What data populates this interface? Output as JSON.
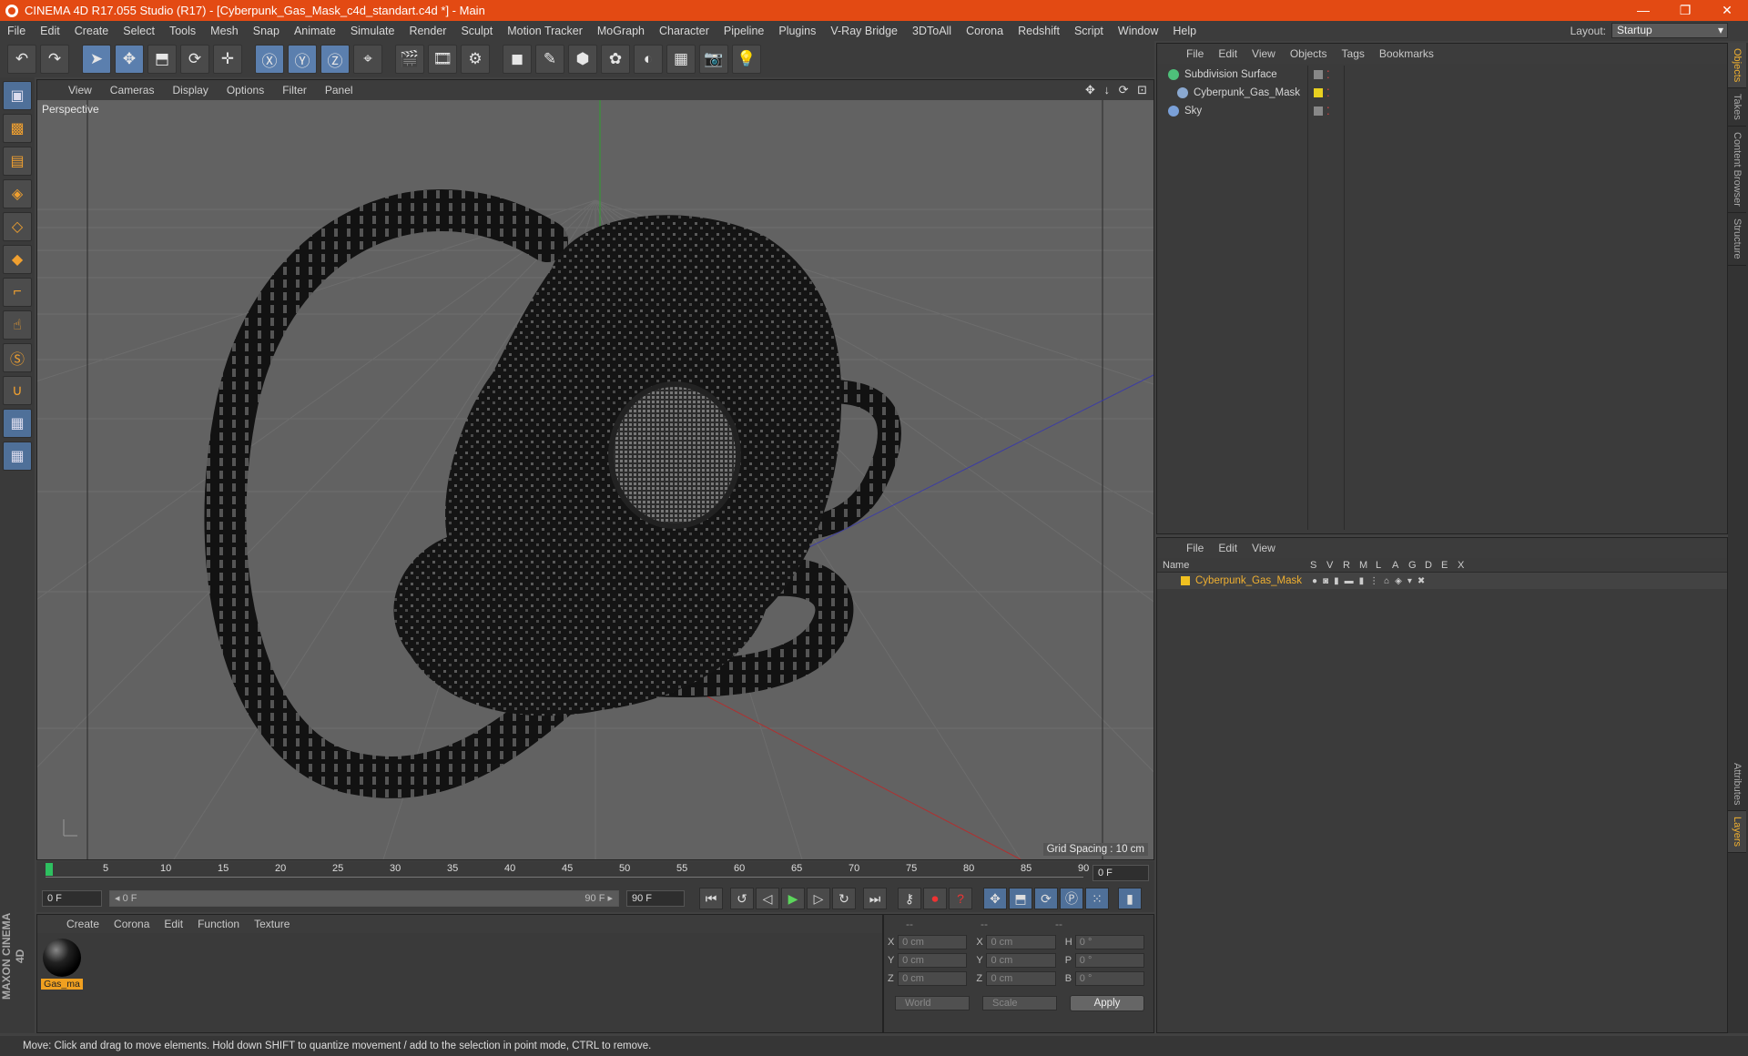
{
  "window": {
    "title": "CINEMA 4D R17.055 Studio (R17) - [Cyberpunk_Gas_Mask_c4d_standart.c4d *] - Main",
    "minimize": "—",
    "restore": "❐",
    "close": "✕"
  },
  "menu": [
    "File",
    "Edit",
    "Create",
    "Select",
    "Tools",
    "Mesh",
    "Snap",
    "Animate",
    "Simulate",
    "Render",
    "Sculpt",
    "Motion Tracker",
    "MoGraph",
    "Character",
    "Pipeline",
    "Plugins",
    "V-Ray Bridge",
    "3DToAll",
    "Corona",
    "Redshift",
    "Script",
    "Window",
    "Help"
  ],
  "layout": {
    "label": "Layout:",
    "value": "Startup"
  },
  "toolbar": [
    {
      "name": "undo-icon",
      "glyph": "↶"
    },
    {
      "name": "redo-icon",
      "glyph": "↷"
    },
    {
      "name": "select-arrow-icon",
      "glyph": "➤",
      "active": true
    },
    {
      "name": "move-icon",
      "glyph": "✥",
      "active": true
    },
    {
      "name": "scale-icon",
      "glyph": "⬒"
    },
    {
      "name": "rotate-icon",
      "glyph": "⟳"
    },
    {
      "name": "move-plus-icon",
      "glyph": "✛"
    },
    {
      "name": "x-axis-icon",
      "glyph": "Ⓧ",
      "active": true
    },
    {
      "name": "y-axis-icon",
      "glyph": "Ⓨ",
      "active": true
    },
    {
      "name": "z-axis-icon",
      "glyph": "Ⓩ",
      "active": true
    },
    {
      "name": "coordinate-system-icon",
      "glyph": "⌖"
    },
    {
      "name": "render-view-icon",
      "glyph": "🎬"
    },
    {
      "name": "render-picture-viewer-icon",
      "glyph": "🎞"
    },
    {
      "name": "render-settings-icon",
      "glyph": "⚙"
    },
    {
      "name": "cube-icon",
      "glyph": "◼"
    },
    {
      "name": "pen-spline-icon",
      "glyph": "✎"
    },
    {
      "name": "subdivision-icon",
      "glyph": "⬢"
    },
    {
      "name": "mograph-cloner-icon",
      "glyph": "✿"
    },
    {
      "name": "deformer-icon",
      "glyph": "◐"
    },
    {
      "name": "floor-icon",
      "glyph": "▦"
    },
    {
      "name": "camera-icon",
      "glyph": "📷"
    },
    {
      "name": "light-icon",
      "glyph": "💡"
    }
  ],
  "lefttools": [
    {
      "name": "model-mode-icon",
      "glyph": "▣"
    },
    {
      "name": "texture-mode-icon",
      "glyph": "▩"
    },
    {
      "name": "workplane-icon",
      "glyph": "▤"
    },
    {
      "name": "points-mode-icon",
      "glyph": "◈"
    },
    {
      "name": "edges-mode-icon",
      "glyph": "◇"
    },
    {
      "name": "polygons-mode-icon",
      "glyph": "◆"
    },
    {
      "name": "axis-mode-icon",
      "glyph": "⌐"
    },
    {
      "name": "tweak-mode-icon",
      "glyph": "☝"
    },
    {
      "name": "snap-icon",
      "glyph": "Ⓢ"
    },
    {
      "name": "magnet-icon",
      "glyph": "∪"
    },
    {
      "name": "grid-lock-icon",
      "glyph": "▦"
    },
    {
      "name": "grid-animate-icon",
      "glyph": "▦"
    }
  ],
  "maxon": "MAXON CINEMA 4D",
  "viewport": {
    "menu": [
      "View",
      "Cameras",
      "Display",
      "Options",
      "Filter",
      "Panel"
    ],
    "nav_icons": "✥ ↓ ⟳ ⊡",
    "label": "Perspective",
    "grid_spacing": "Grid Spacing : 10 cm"
  },
  "timeline": {
    "ticks": [
      "0",
      "5",
      "10",
      "15",
      "20",
      "25",
      "30",
      "35",
      "40",
      "45",
      "50",
      "55",
      "60",
      "65",
      "70",
      "75",
      "80",
      "85",
      "90"
    ],
    "current": "0 F"
  },
  "playbar": {
    "start": "0 F",
    "range_start": "◂ 0 F",
    "range_end": "90 F ▸",
    "end": "90 F"
  },
  "materials": {
    "menu": [
      "Create",
      "Corona",
      "Edit",
      "Function",
      "Texture"
    ],
    "items": [
      {
        "label": "Gas_ma"
      }
    ]
  },
  "coords": {
    "headers": [
      "--",
      "--",
      "--"
    ],
    "rows": [
      {
        "a": "X",
        "v1": "0 cm",
        "b": "X",
        "v2": "0 cm",
        "c": "H",
        "v3": "0 °"
      },
      {
        "a": "Y",
        "v1": "0 cm",
        "b": "Y",
        "v2": "0 cm",
        "c": "P",
        "v3": "0 °"
      },
      {
        "a": "Z",
        "v1": "0 cm",
        "b": "Z",
        "v2": "0 cm",
        "c": "B",
        "v3": "0 °"
      }
    ],
    "world": "World",
    "scale": "Scale",
    "apply": "Apply"
  },
  "objects": {
    "menu": [
      "File",
      "Edit",
      "View",
      "Objects",
      "Tags",
      "Bookmarks"
    ],
    "items": [
      {
        "label": "Subdivision Surface",
        "color": "#4ec07a"
      },
      {
        "label": "Cyberpunk_Gas_Mask",
        "color": "#8aa8d0"
      },
      {
        "label": "Sky",
        "color": "#7aa0d8"
      }
    ]
  },
  "layers": {
    "menu": [
      "File",
      "Edit",
      "View"
    ],
    "columns": [
      "Name",
      "S",
      "V",
      "R",
      "M",
      "L",
      "A",
      "G",
      "D",
      "E",
      "X"
    ],
    "row": {
      "label": "Cyberpunk_Gas_Mask",
      "color": "#f0c020"
    }
  },
  "status": "Move: Click and drag to move elements. Hold down SHIFT to quantize movement / add to the selection in point mode, CTRL to remove.",
  "right_tabs": [
    "Objects",
    "Takes",
    "Content Browser",
    "Structure",
    "Attributes",
    "Layers"
  ]
}
